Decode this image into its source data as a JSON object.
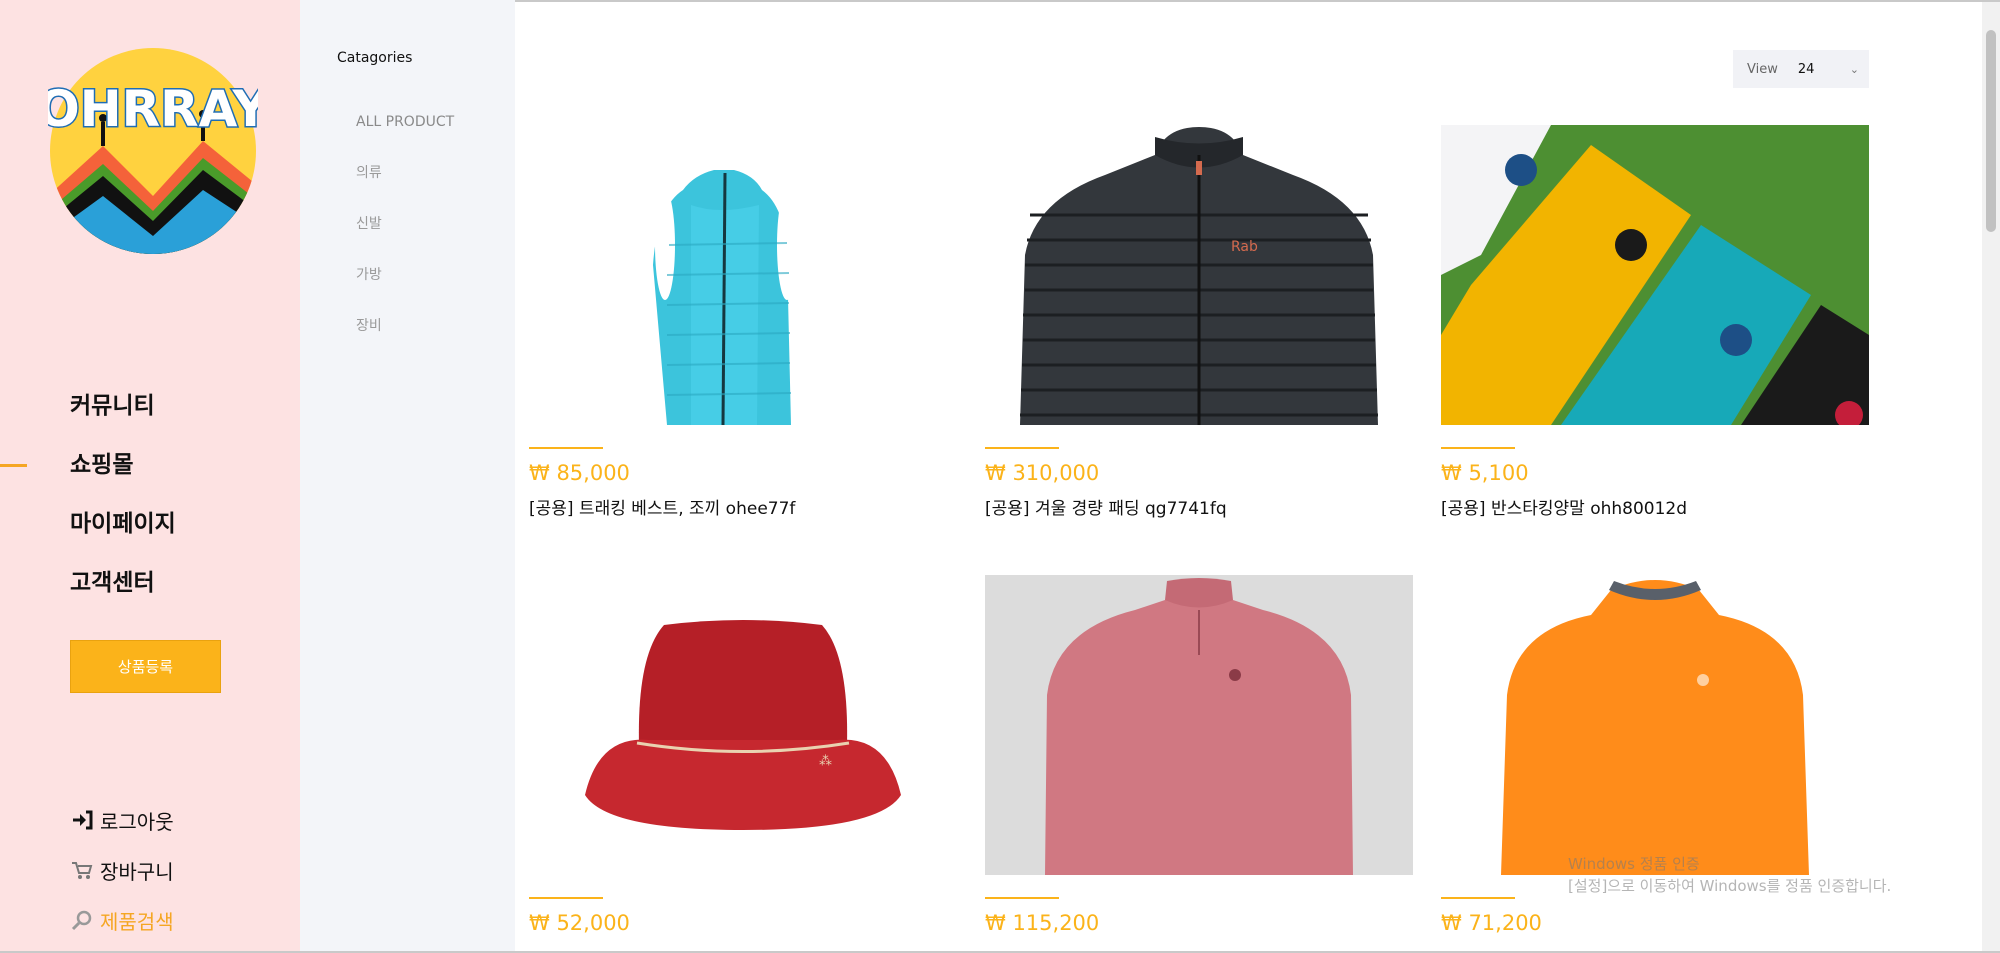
{
  "brand": {
    "name": "OHRRAY"
  },
  "nav": {
    "items": [
      {
        "label": "커뮤니티"
      },
      {
        "label": "쇼핑몰"
      },
      {
        "label": "마이페이지"
      },
      {
        "label": "고객센터"
      }
    ],
    "active_index": 1,
    "register_button": "상품등록"
  },
  "util": {
    "logout": "로그아웃",
    "cart": "장바구니",
    "search": "제품검색"
  },
  "categories": {
    "title": "Catagories",
    "items": [
      "ALL PRODUCT",
      "의류",
      "신발",
      "가방",
      "장비"
    ]
  },
  "view": {
    "label": "View",
    "value": "24"
  },
  "products": [
    {
      "price": "₩ 85,000",
      "name": "[공용] 트래킹 베스트, 조끼 ohee77f"
    },
    {
      "price": "₩ 310,000",
      "name": "[공용] 겨울 경량 패딩 qg7741fq"
    },
    {
      "price": "₩ 5,100",
      "name": "[공용] 반스타킹양말 ohh80012d"
    },
    {
      "price": "₩ 52,000",
      "name": ""
    },
    {
      "price": "₩ 115,200",
      "name": ""
    },
    {
      "price": "₩ 71,200",
      "name": ""
    }
  ],
  "watermark": {
    "line1": "Windows 정품 인증",
    "line2": "[설정]으로 이동하여 Windows를 정품 인증합니다."
  },
  "colors": {
    "accent": "#fbb31a",
    "nav_bg": "#fde2e2",
    "cat_bg": "#f3f5f9"
  }
}
